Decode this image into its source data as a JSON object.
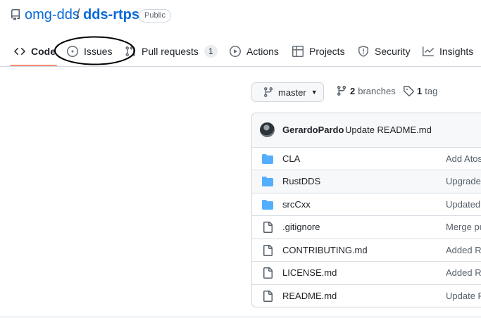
{
  "repo": {
    "owner": "omg-dds",
    "separator": "/",
    "name": "dds-rtps",
    "visibility": "Public"
  },
  "nav": {
    "tabs": [
      {
        "label": "Code",
        "icon": "code-icon"
      },
      {
        "label": "Issues",
        "icon": "issue-opened-icon"
      },
      {
        "label": "Pull requests",
        "icon": "git-pull-request-icon",
        "count": "1"
      },
      {
        "label": "Actions",
        "icon": "play-icon"
      },
      {
        "label": "Projects",
        "icon": "table-icon"
      },
      {
        "label": "Security",
        "icon": "shield-icon"
      },
      {
        "label": "Insights",
        "icon": "graph-icon"
      }
    ],
    "selected": "Code"
  },
  "branch_bar": {
    "current_branch": "master",
    "branches_count": "2",
    "branches_label": "branches",
    "tags_count": "1",
    "tags_label": "tag"
  },
  "commit": {
    "author": "GerardoPardo",
    "message": "Update README.md"
  },
  "files": [
    {
      "name": "CLA",
      "type": "folder",
      "last_commit": "Add Atos"
    },
    {
      "name": "RustDDS",
      "type": "folder",
      "last_commit": "Upgrade"
    },
    {
      "name": "srcCxx",
      "type": "folder",
      "last_commit": "Updated"
    },
    {
      "name": ".gitignore",
      "type": "file",
      "last_commit": "Merge pu"
    },
    {
      "name": "CONTRIBUTING.md",
      "type": "file",
      "last_commit": "Added R"
    },
    {
      "name": "LICENSE.md",
      "type": "file",
      "last_commit": "Added R"
    },
    {
      "name": "README.md",
      "type": "file",
      "last_commit": "Update R"
    }
  ],
  "colors": {
    "link": "#0969da",
    "selected_tab_underline": "#fd8c73",
    "folder_icon": "#54aeff",
    "annotation": "#000000"
  }
}
